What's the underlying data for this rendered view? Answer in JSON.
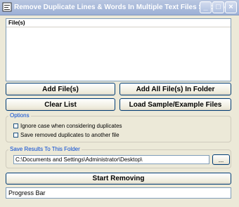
{
  "window": {
    "title": "Remove Duplicate Lines & Words In Multiple Text Files Software",
    "minimize_icon": "minimize-icon",
    "maximize_icon": "maximize-icon",
    "close_icon": "close-icon"
  },
  "files": {
    "header": "File(s)"
  },
  "buttons": {
    "add_files": "Add File(s)",
    "add_all_files": "Add All File(s) In Folder",
    "clear_list": "Clear List",
    "load_sample": "Load Sample/Example Files",
    "start": "Start Removing"
  },
  "options": {
    "legend": "Options",
    "ignore_case": "Ignore case when considering duplicates",
    "save_removed": "Save removed duplicates to another file"
  },
  "save_folder": {
    "legend": "Save Results To This Folder",
    "path": "C:\\Documents and Settings\\Administrator\\Desktop\\",
    "browse": "..."
  },
  "progress": {
    "label": "Progress Bar"
  },
  "colors": {
    "titlebar": "#9db1d6",
    "group_legend": "#0046d5",
    "window_bg": "#ece9d8"
  }
}
